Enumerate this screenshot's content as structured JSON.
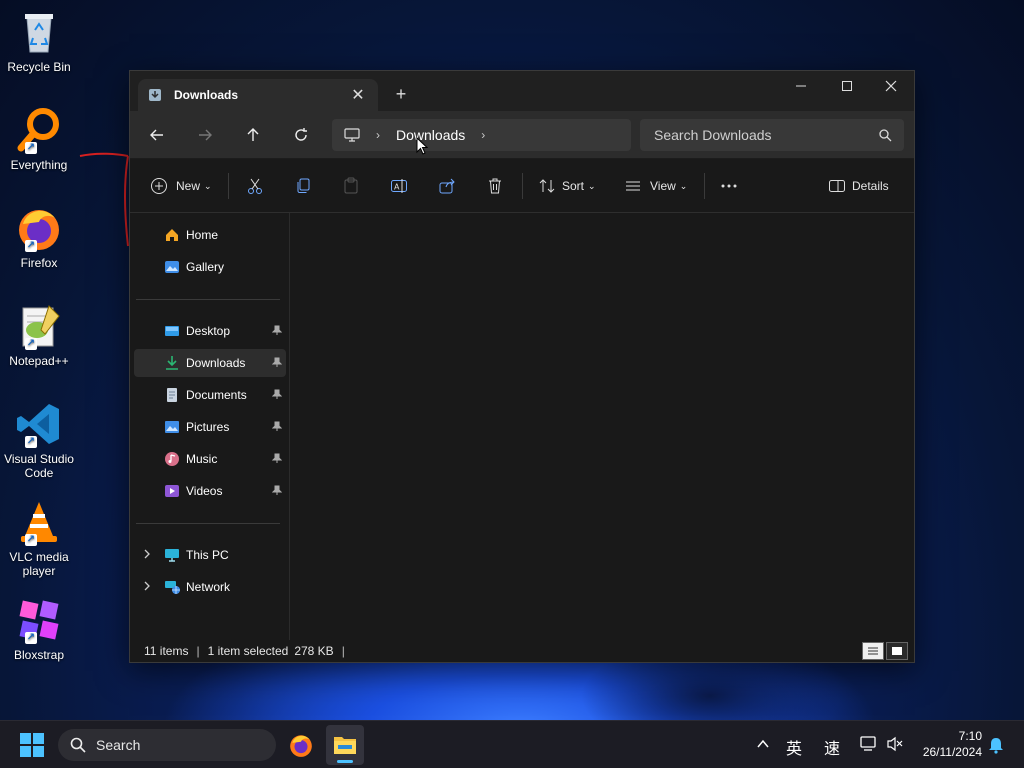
{
  "desktop": {
    "icons": [
      {
        "label": "Recycle Bin",
        "icon": "recycle-bin-icon"
      },
      {
        "label": "Everything",
        "icon": "everything-search-icon"
      },
      {
        "label": "Firefox",
        "icon": "firefox-icon"
      },
      {
        "label": "Notepad++",
        "icon": "notepad-plus-plus-icon"
      },
      {
        "label": "Visual Studio Code",
        "icon": "vscode-icon"
      },
      {
        "label": "VLC media player",
        "icon": "vlc-icon"
      },
      {
        "label": "Bloxstrap",
        "icon": "bloxstrap-icon"
      }
    ]
  },
  "window": {
    "tab_title": "Downloads",
    "address": {
      "crumb": "Downloads",
      "search_placeholder": "Search Downloads"
    },
    "toolbar": {
      "new_label": "New",
      "sort_label": "Sort",
      "view_label": "View",
      "details_label": "Details"
    },
    "sidebar": {
      "quick": [
        {
          "label": "Home",
          "icon": "home-icon"
        },
        {
          "label": "Gallery",
          "icon": "gallery-icon"
        }
      ],
      "pinned": [
        {
          "label": "Desktop",
          "icon": "desktop-folder-icon"
        },
        {
          "label": "Downloads",
          "icon": "downloads-folder-icon",
          "selected": true
        },
        {
          "label": "Documents",
          "icon": "documents-folder-icon"
        },
        {
          "label": "Pictures",
          "icon": "pictures-folder-icon"
        },
        {
          "label": "Music",
          "icon": "music-folder-icon"
        },
        {
          "label": "Videos",
          "icon": "videos-folder-icon"
        }
      ],
      "locations": [
        {
          "label": "This PC",
          "icon": "this-pc-icon"
        },
        {
          "label": "Network",
          "icon": "network-icon"
        }
      ]
    },
    "status": {
      "items": "11 items",
      "selected": "1 item selected",
      "size": "278 KB"
    }
  },
  "taskbar": {
    "search_label": "Search",
    "ime_lang": "英",
    "ime_mode": "速",
    "time": "7:10",
    "date": "26/11/2024"
  },
  "colors": {
    "window_bg": "#191919",
    "addressbar_bg": "#2c2c2c",
    "accent": "#3b7cff"
  }
}
